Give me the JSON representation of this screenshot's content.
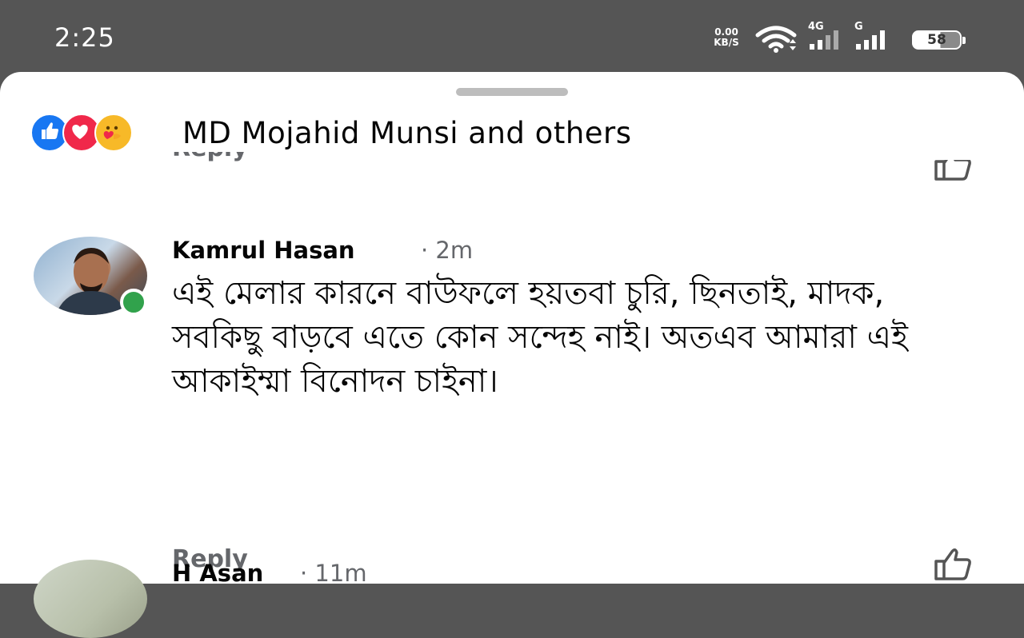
{
  "status_bar": {
    "time": "2:25",
    "speed_value": "0.00",
    "speed_unit": "KB/S",
    "network1_label": "4G",
    "network2_label": "G",
    "battery_level": "58",
    "icons": [
      "wifi-icon",
      "signal-icon",
      "signal-icon",
      "battery-icon"
    ]
  },
  "reactions": {
    "icons": [
      "like-reaction-icon",
      "love-reaction-icon",
      "care-reaction-icon"
    ],
    "summary": "MD Mojahid Munsi and others"
  },
  "previous_comment": {
    "reply_label": "Reply"
  },
  "comment": {
    "author": "Kamrul Hasan",
    "time_ago": "· 2m",
    "text": "এই মেলার কারনে বাউফলে হয়তবা চুরি, ছিনতাই, মাদক, সবকিছু বাড়বে এতে কোন সন্দেহ নাই। অতএব আমারা এই আকাইম্মা বিনোদন চাইনা।",
    "reply_label": "Reply",
    "online": true
  },
  "next_comment": {
    "author": "H Asan",
    "time_ago": "· 11m"
  },
  "colors": {
    "status_bar_bg": "#555555",
    "sheet_bg": "#ffffff",
    "like_blue": "#1877f2",
    "love_red": "#f0284a",
    "care_yellow": "#f7b928",
    "online_green": "#31a24c",
    "secondary_text": "#65676b"
  }
}
